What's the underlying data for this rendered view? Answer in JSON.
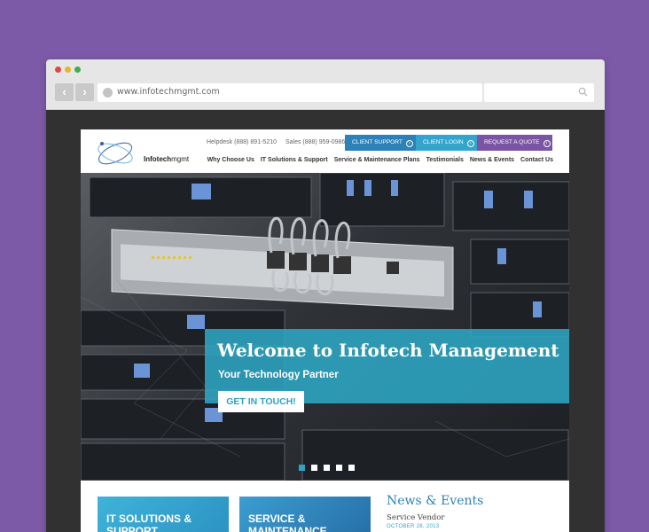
{
  "browser": {
    "url": "www.infotechmgmt.com"
  },
  "site": {
    "logo": {
      "brand_bold": "Infotech",
      "brand_light": "mgmt"
    },
    "helpdesk": "Helpdesk (888) 891-5210",
    "sales": "Sales (888) 959-0986",
    "cta": {
      "support": "CLIENT SUPPORT",
      "login": "CLIENT LOGIN",
      "quote": "REQUEST A QUOTE"
    },
    "nav": [
      "Why Choose Us",
      "IT Solutions & Support",
      "Service & Maintenance Plans",
      "Testimonials",
      "News & Events",
      "Contact Us"
    ]
  },
  "hero": {
    "title": "Welcome to Infotech Management",
    "subtitle": "Your Technology Partner",
    "button": "GET IN TOUCH!",
    "slides": 5,
    "active_slide": 1
  },
  "tiles": [
    {
      "label": "IT SOLUTIONS & SUPPORT"
    },
    {
      "label": "SERVICE & MAINTENANCE"
    }
  ],
  "news": {
    "heading": "News & Events",
    "item_title": "Service Vendor",
    "item_date": "OCTOBER 28, 2013"
  },
  "colors": {
    "background": "#7d5aa8",
    "primary_blue": "#2c82b8",
    "light_blue": "#33a4cd",
    "purple": "#7a55a3",
    "teal_banner": "#2eaac8"
  }
}
